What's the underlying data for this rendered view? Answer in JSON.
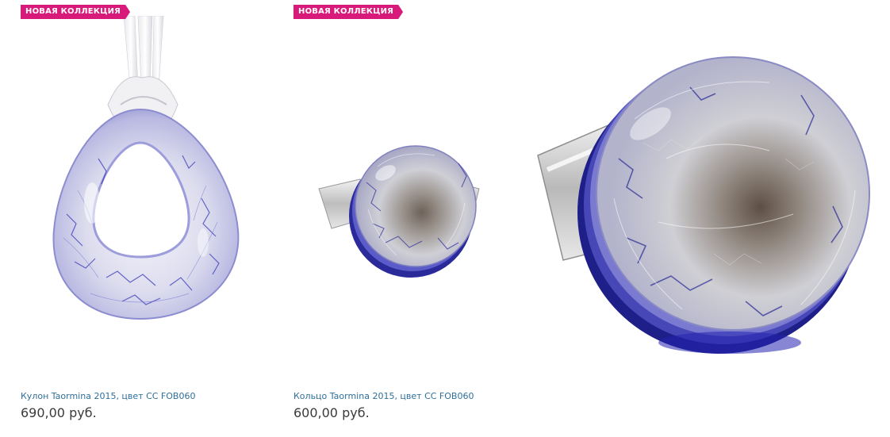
{
  "products": [
    {
      "badge": "НОВАЯ КОЛЛЕКЦИЯ",
      "title": "Кулон Taormina 2015, цвет CC FOB060",
      "price": "690,00 руб.",
      "image_icon": "pendant-image"
    },
    {
      "badge": "НОВАЯ КОЛЛЕКЦИЯ",
      "title": "Кольцо Taormina 2015, цвет CC FOB060",
      "price": "600,00 руб.",
      "image_icon": "ring-image"
    }
  ],
  "zoom_preview": {
    "image_icon": "ring-zoom-image"
  },
  "colors": {
    "badge": "#d81b7a",
    "title_link": "#2f6f9a",
    "price_text": "#3a3a3a",
    "glass_blue": "#3a3ab8"
  }
}
